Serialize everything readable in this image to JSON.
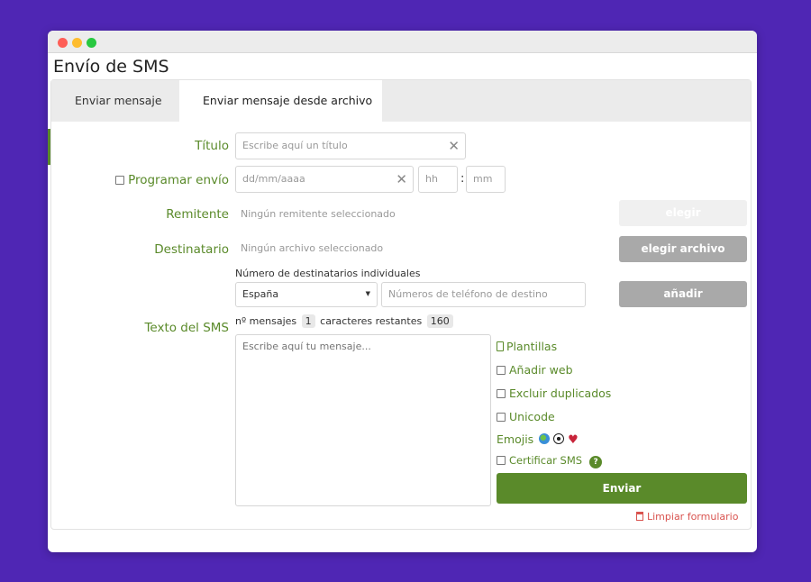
{
  "window": {
    "title": "Envío de SMS"
  },
  "tabs": [
    {
      "label": "Enviar mensaje"
    },
    {
      "label": "Enviar mensaje desde archivo"
    }
  ],
  "form": {
    "titulo": {
      "label": "Título",
      "placeholder": "Escribe aquí un título"
    },
    "programar": {
      "label": "Programar envío",
      "date_placeholder": "dd/mm/aaaa",
      "hour_placeholder": "hh",
      "separator": ":",
      "min_placeholder": "mm"
    },
    "remitente": {
      "label": "Remitente",
      "value": "Ningún remitente seleccionado",
      "button": "elegir"
    },
    "destinatario": {
      "label": "Destinatario",
      "value": "Ningún archivo seleccionado",
      "button": "elegir archivo"
    },
    "individuales": {
      "label": "Número de destinatarios individuales",
      "country": "España",
      "phone_placeholder": "Números de teléfono de destino",
      "button": "añadir"
    },
    "sms": {
      "label": "Texto del SMS",
      "messages_label": "nº mensajes",
      "messages_count": "1",
      "chars_label": "caracteres restantes",
      "chars_count": "160",
      "placeholder": "Escribe aquí tu mensaje..."
    },
    "options": {
      "plantillas": "Plantillas",
      "anadir_web": "Añadir web",
      "excluir_duplicados": "Excluir duplicados",
      "unicode": "Unicode",
      "emojis": "Emojis",
      "certificar": "Certificar SMS"
    },
    "send_button": "Enviar",
    "clear_link": "Limpiar formulario"
  },
  "colors": {
    "accent": "#5a8a2a",
    "background": "#4f26b4",
    "disabled_button": "#f0f0f0",
    "gray_button": "#a9a9a9",
    "clear_link": "#d9534f"
  },
  "icons": [
    "close-icon",
    "calendar-clear-icon",
    "dropdown-arrow-icon",
    "document-icon",
    "globe-emoji-icon",
    "soccer-ball-emoji-icon",
    "heart-emoji-icon",
    "help-icon",
    "trash-icon"
  ]
}
